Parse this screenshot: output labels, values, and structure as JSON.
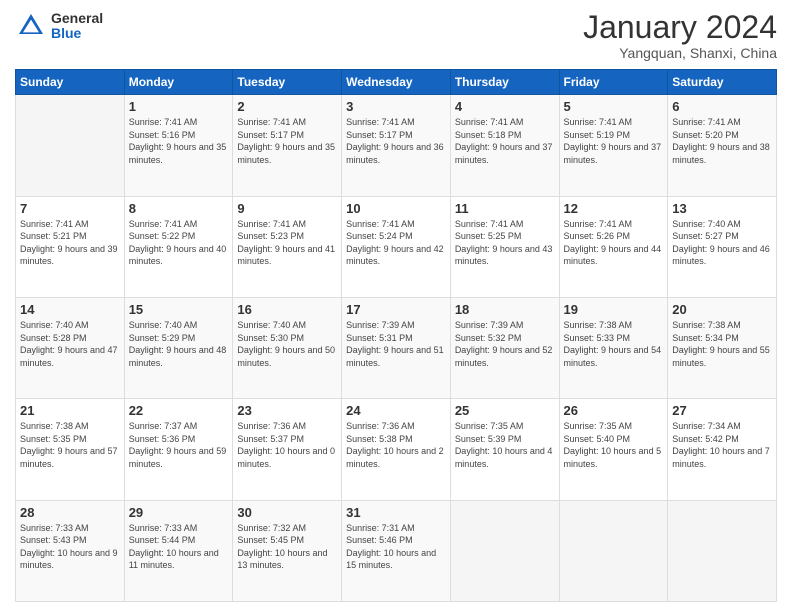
{
  "header": {
    "logo_general": "General",
    "logo_blue": "Blue",
    "title": "January 2024",
    "subtitle": "Yangquan, Shanxi, China"
  },
  "days_of_week": [
    "Sunday",
    "Monday",
    "Tuesday",
    "Wednesday",
    "Thursday",
    "Friday",
    "Saturday"
  ],
  "weeks": [
    [
      {
        "day": "",
        "sunrise": "",
        "sunset": "",
        "daylight": ""
      },
      {
        "day": "1",
        "sunrise": "Sunrise: 7:41 AM",
        "sunset": "Sunset: 5:16 PM",
        "daylight": "Daylight: 9 hours and 35 minutes."
      },
      {
        "day": "2",
        "sunrise": "Sunrise: 7:41 AM",
        "sunset": "Sunset: 5:17 PM",
        "daylight": "Daylight: 9 hours and 35 minutes."
      },
      {
        "day": "3",
        "sunrise": "Sunrise: 7:41 AM",
        "sunset": "Sunset: 5:17 PM",
        "daylight": "Daylight: 9 hours and 36 minutes."
      },
      {
        "day": "4",
        "sunrise": "Sunrise: 7:41 AM",
        "sunset": "Sunset: 5:18 PM",
        "daylight": "Daylight: 9 hours and 37 minutes."
      },
      {
        "day": "5",
        "sunrise": "Sunrise: 7:41 AM",
        "sunset": "Sunset: 5:19 PM",
        "daylight": "Daylight: 9 hours and 37 minutes."
      },
      {
        "day": "6",
        "sunrise": "Sunrise: 7:41 AM",
        "sunset": "Sunset: 5:20 PM",
        "daylight": "Daylight: 9 hours and 38 minutes."
      }
    ],
    [
      {
        "day": "7",
        "sunrise": "Sunrise: 7:41 AM",
        "sunset": "Sunset: 5:21 PM",
        "daylight": "Daylight: 9 hours and 39 minutes."
      },
      {
        "day": "8",
        "sunrise": "Sunrise: 7:41 AM",
        "sunset": "Sunset: 5:22 PM",
        "daylight": "Daylight: 9 hours and 40 minutes."
      },
      {
        "day": "9",
        "sunrise": "Sunrise: 7:41 AM",
        "sunset": "Sunset: 5:23 PM",
        "daylight": "Daylight: 9 hours and 41 minutes."
      },
      {
        "day": "10",
        "sunrise": "Sunrise: 7:41 AM",
        "sunset": "Sunset: 5:24 PM",
        "daylight": "Daylight: 9 hours and 42 minutes."
      },
      {
        "day": "11",
        "sunrise": "Sunrise: 7:41 AM",
        "sunset": "Sunset: 5:25 PM",
        "daylight": "Daylight: 9 hours and 43 minutes."
      },
      {
        "day": "12",
        "sunrise": "Sunrise: 7:41 AM",
        "sunset": "Sunset: 5:26 PM",
        "daylight": "Daylight: 9 hours and 44 minutes."
      },
      {
        "day": "13",
        "sunrise": "Sunrise: 7:40 AM",
        "sunset": "Sunset: 5:27 PM",
        "daylight": "Daylight: 9 hours and 46 minutes."
      }
    ],
    [
      {
        "day": "14",
        "sunrise": "Sunrise: 7:40 AM",
        "sunset": "Sunset: 5:28 PM",
        "daylight": "Daylight: 9 hours and 47 minutes."
      },
      {
        "day": "15",
        "sunrise": "Sunrise: 7:40 AM",
        "sunset": "Sunset: 5:29 PM",
        "daylight": "Daylight: 9 hours and 48 minutes."
      },
      {
        "day": "16",
        "sunrise": "Sunrise: 7:40 AM",
        "sunset": "Sunset: 5:30 PM",
        "daylight": "Daylight: 9 hours and 50 minutes."
      },
      {
        "day": "17",
        "sunrise": "Sunrise: 7:39 AM",
        "sunset": "Sunset: 5:31 PM",
        "daylight": "Daylight: 9 hours and 51 minutes."
      },
      {
        "day": "18",
        "sunrise": "Sunrise: 7:39 AM",
        "sunset": "Sunset: 5:32 PM",
        "daylight": "Daylight: 9 hours and 52 minutes."
      },
      {
        "day": "19",
        "sunrise": "Sunrise: 7:38 AM",
        "sunset": "Sunset: 5:33 PM",
        "daylight": "Daylight: 9 hours and 54 minutes."
      },
      {
        "day": "20",
        "sunrise": "Sunrise: 7:38 AM",
        "sunset": "Sunset: 5:34 PM",
        "daylight": "Daylight: 9 hours and 55 minutes."
      }
    ],
    [
      {
        "day": "21",
        "sunrise": "Sunrise: 7:38 AM",
        "sunset": "Sunset: 5:35 PM",
        "daylight": "Daylight: 9 hours and 57 minutes."
      },
      {
        "day": "22",
        "sunrise": "Sunrise: 7:37 AM",
        "sunset": "Sunset: 5:36 PM",
        "daylight": "Daylight: 9 hours and 59 minutes."
      },
      {
        "day": "23",
        "sunrise": "Sunrise: 7:36 AM",
        "sunset": "Sunset: 5:37 PM",
        "daylight": "Daylight: 10 hours and 0 minutes."
      },
      {
        "day": "24",
        "sunrise": "Sunrise: 7:36 AM",
        "sunset": "Sunset: 5:38 PM",
        "daylight": "Daylight: 10 hours and 2 minutes."
      },
      {
        "day": "25",
        "sunrise": "Sunrise: 7:35 AM",
        "sunset": "Sunset: 5:39 PM",
        "daylight": "Daylight: 10 hours and 4 minutes."
      },
      {
        "day": "26",
        "sunrise": "Sunrise: 7:35 AM",
        "sunset": "Sunset: 5:40 PM",
        "daylight": "Daylight: 10 hours and 5 minutes."
      },
      {
        "day": "27",
        "sunrise": "Sunrise: 7:34 AM",
        "sunset": "Sunset: 5:42 PM",
        "daylight": "Daylight: 10 hours and 7 minutes."
      }
    ],
    [
      {
        "day": "28",
        "sunrise": "Sunrise: 7:33 AM",
        "sunset": "Sunset: 5:43 PM",
        "daylight": "Daylight: 10 hours and 9 minutes."
      },
      {
        "day": "29",
        "sunrise": "Sunrise: 7:33 AM",
        "sunset": "Sunset: 5:44 PM",
        "daylight": "Daylight: 10 hours and 11 minutes."
      },
      {
        "day": "30",
        "sunrise": "Sunrise: 7:32 AM",
        "sunset": "Sunset: 5:45 PM",
        "daylight": "Daylight: 10 hours and 13 minutes."
      },
      {
        "day": "31",
        "sunrise": "Sunrise: 7:31 AM",
        "sunset": "Sunset: 5:46 PM",
        "daylight": "Daylight: 10 hours and 15 minutes."
      },
      {
        "day": "",
        "sunrise": "",
        "sunset": "",
        "daylight": ""
      },
      {
        "day": "",
        "sunrise": "",
        "sunset": "",
        "daylight": ""
      },
      {
        "day": "",
        "sunrise": "",
        "sunset": "",
        "daylight": ""
      }
    ]
  ]
}
